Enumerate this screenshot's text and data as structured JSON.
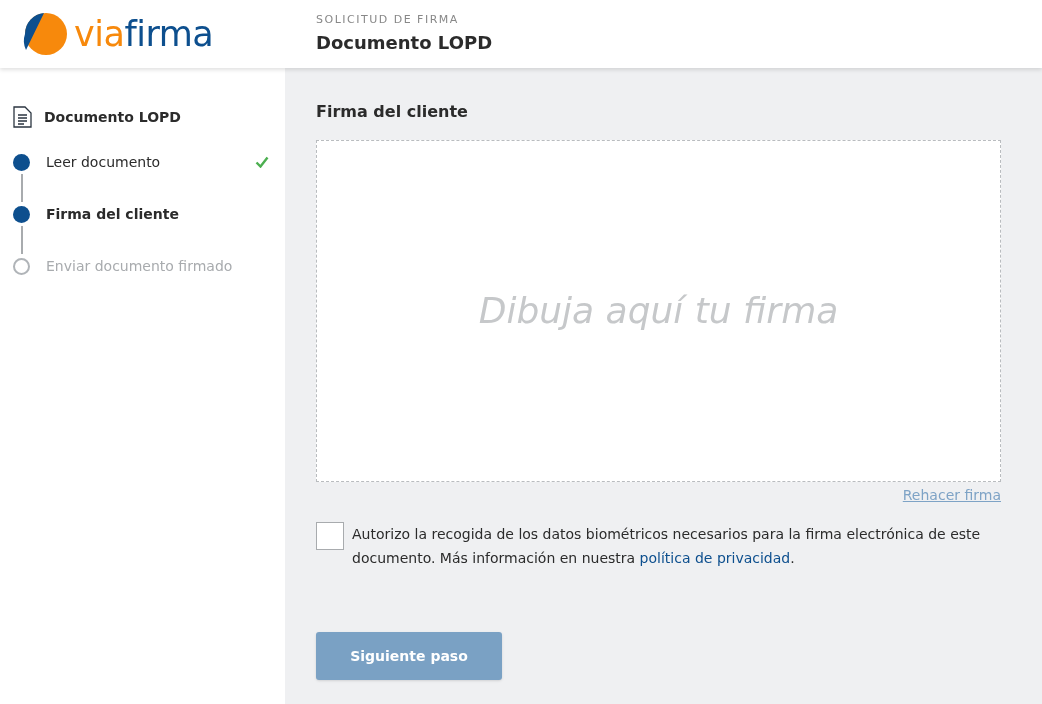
{
  "header": {
    "logo": {
      "part_1": "via",
      "part_2": "firma"
    },
    "subtitle": "SOLICITUD DE FIRMA",
    "title": "Documento LOPD"
  },
  "sidebar": {
    "document_title": "Documento LOPD",
    "steps": [
      {
        "label": "Leer documento",
        "completed": true,
        "selected": false
      },
      {
        "label": "Firma del cliente",
        "completed": false,
        "selected": true
      },
      {
        "label": "Enviar documento firmado",
        "completed": false,
        "selected": false
      }
    ]
  },
  "main": {
    "section_title": "Firma del cliente",
    "signature_pad": {
      "placeholder": "Dibuja aquí tu firma"
    },
    "redo_link": "Rehacer firma",
    "consent": {
      "checked": false,
      "text": "Autorizo la recogida de los datos biométricos necesarios para la firma electrónica de este documento. Más información en nuestra ",
      "link": "política de privacidad",
      "suffix": "."
    },
    "next_button": {
      "label": "Siguiente paso",
      "disabled": true
    }
  }
}
